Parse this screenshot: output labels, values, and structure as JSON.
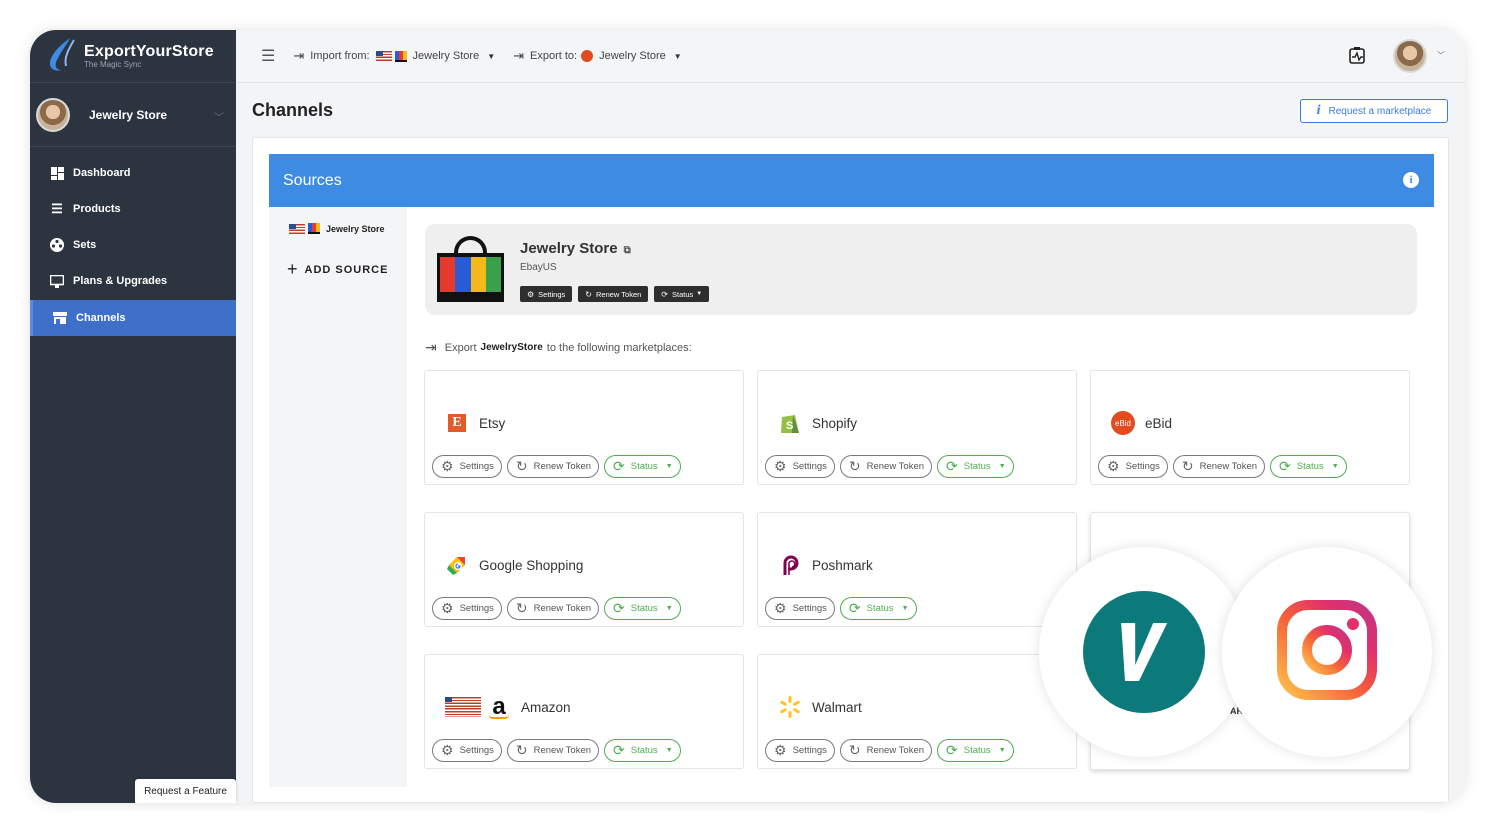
{
  "app": {
    "name": "ExportYourStore",
    "tagline": "The Magic Sync"
  },
  "sidebar": {
    "store_name": "Jewelry Store",
    "items": [
      {
        "label": "Dashboard",
        "icon": "dashboard-icon"
      },
      {
        "label": "Products",
        "icon": "list-icon"
      },
      {
        "label": "Sets",
        "icon": "film-reel-icon"
      },
      {
        "label": "Plans & Upgrades",
        "icon": "monitor-icon"
      },
      {
        "label": "Channels",
        "icon": "store-icon",
        "active": true
      }
    ],
    "request_feature": "Request a Feature"
  },
  "topbar": {
    "import_label": "Import from:",
    "import_store": "Jewelry Store",
    "export_label": "Export to:",
    "export_store": "Jewelry Store"
  },
  "page": {
    "title": "Channels",
    "request_marketplace": "Request a marketplace"
  },
  "sources": {
    "header": "Sources",
    "list_item": "Jewelry Store",
    "add_source": "ADD SOURCE",
    "store": {
      "title": "Jewelry Store",
      "subtitle": "EbayUS",
      "settings": "Settings",
      "renew": "Renew Token",
      "status": "Status"
    },
    "export_prefix": "Export",
    "export_store": "JewelryStore",
    "export_suffix": "to the following marketplaces:"
  },
  "marketplaces": [
    {
      "name": "Etsy",
      "icon": "etsy-icon"
    },
    {
      "name": "Shopify",
      "icon": "shopify-icon"
    },
    {
      "name": "eBid",
      "icon": "ebid-icon"
    },
    {
      "name": "Google Shopping",
      "icon": "google-shopping-icon"
    },
    {
      "name": "Poshmark",
      "icon": "poshmark-icon"
    },
    {
      "name": "Amazon",
      "icon": "amazon-icon"
    },
    {
      "name": "Walmart",
      "icon": "walmart-icon"
    }
  ],
  "buttons": {
    "settings": "Settings",
    "renew": "Renew Token",
    "status": "Status"
  },
  "partial_text": "AR",
  "ebid_logo_text": "eBid",
  "colors": {
    "accent": "#3e8be3",
    "sidebar": "#2c3440",
    "active": "#3e6fc9",
    "status_green": "#4caf50",
    "vinted": "#0c7a7a"
  }
}
